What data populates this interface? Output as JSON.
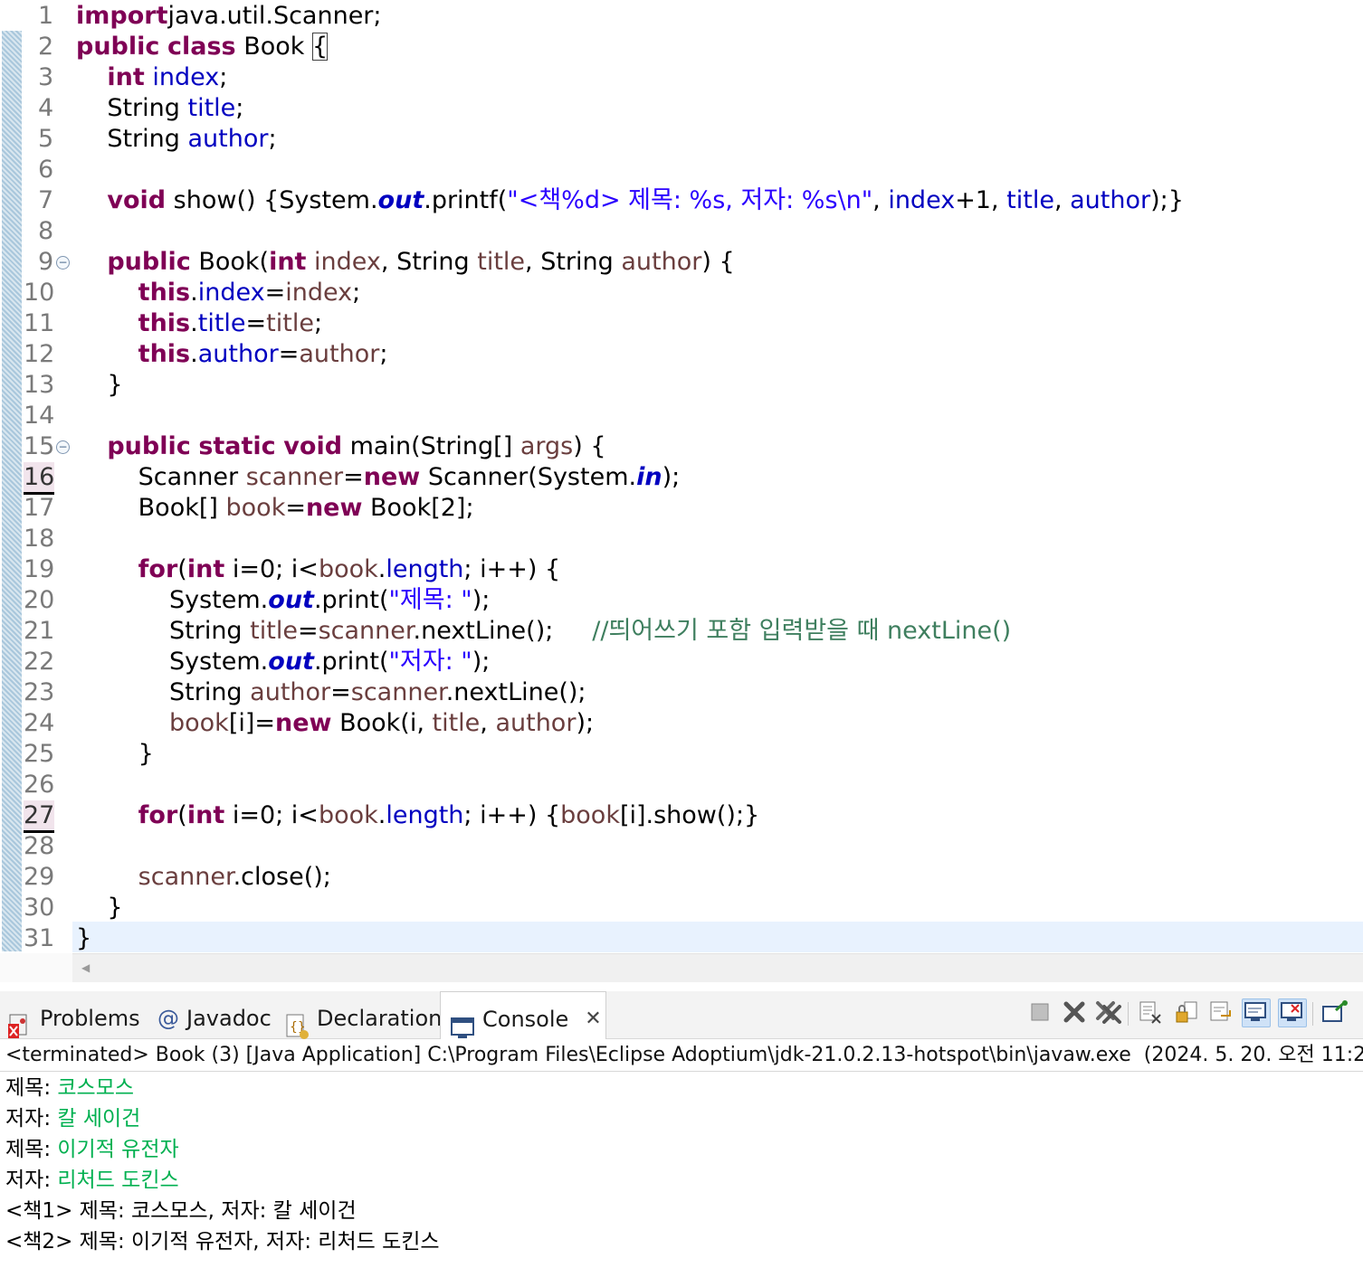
{
  "editor": {
    "line_numbers": [
      "1",
      "2",
      "3",
      "4",
      "5",
      "6",
      "7",
      "8",
      "9",
      "10",
      "11",
      "12",
      "13",
      "14",
      "15",
      "16",
      "17",
      "18",
      "19",
      "20",
      "21",
      "22",
      "23",
      "24",
      "25",
      "26",
      "27",
      "28",
      "29",
      "30",
      "31"
    ],
    "breakpoint_lines": [
      "16",
      "27"
    ],
    "fold_markers": [
      "⊖",
      "⊖"
    ],
    "lines": [
      [
        [
          "kw",
          "import"
        ],
        [
          "",
          "java.util.Scanner;"
        ]
      ],
      [
        [
          "kw",
          "public"
        ],
        [
          "",
          " "
        ],
        [
          "kw",
          "class"
        ],
        [
          "",
          " Book "
        ],
        [
          "brk",
          "{"
        ]
      ],
      [
        [
          "",
          "    "
        ],
        [
          "kw",
          "int"
        ],
        [
          "",
          " "
        ],
        [
          "fd",
          "index"
        ],
        [
          "",
          ";"
        ]
      ],
      [
        [
          "",
          "    String "
        ],
        [
          "fd",
          "title"
        ],
        [
          "",
          ";"
        ]
      ],
      [
        [
          "",
          "    String "
        ],
        [
          "fd",
          "author"
        ],
        [
          "",
          ";"
        ]
      ],
      [],
      [
        [
          "",
          "    "
        ],
        [
          "kw",
          "void"
        ],
        [
          "",
          " show() {System."
        ],
        [
          "sf",
          "out"
        ],
        [
          "",
          ".printf("
        ],
        [
          "st",
          "\"<책%d> 제목: %s, 저자: %s\\n\""
        ],
        [
          "",
          ", "
        ],
        [
          "fd",
          "index"
        ],
        [
          "",
          "+1, "
        ],
        [
          "fd",
          "title"
        ],
        [
          "",
          ", "
        ],
        [
          "fd",
          "author"
        ],
        [
          "",
          ");}"
        ]
      ],
      [],
      [
        [
          "",
          "    "
        ],
        [
          "kw",
          "public"
        ],
        [
          "",
          " Book("
        ],
        [
          "kw",
          "int"
        ],
        [
          "",
          " "
        ],
        [
          "vr",
          "index"
        ],
        [
          "",
          ", String "
        ],
        [
          "vr",
          "title"
        ],
        [
          "",
          ", String "
        ],
        [
          "vr",
          "author"
        ],
        [
          "",
          ") {"
        ]
      ],
      [
        [
          "",
          "        "
        ],
        [
          "kw",
          "this"
        ],
        [
          "",
          "."
        ],
        [
          "fd",
          "index"
        ],
        [
          "",
          "="
        ],
        [
          "vr",
          "index"
        ],
        [
          "",
          ";"
        ]
      ],
      [
        [
          "",
          "        "
        ],
        [
          "kw",
          "this"
        ],
        [
          "",
          "."
        ],
        [
          "fd",
          "title"
        ],
        [
          "",
          "="
        ],
        [
          "vr",
          "title"
        ],
        [
          "",
          ";"
        ]
      ],
      [
        [
          "",
          "        "
        ],
        [
          "kw",
          "this"
        ],
        [
          "",
          "."
        ],
        [
          "fd",
          "author"
        ],
        [
          "",
          "="
        ],
        [
          "vr",
          "author"
        ],
        [
          "",
          ";"
        ]
      ],
      [
        [
          "",
          "    }"
        ]
      ],
      [],
      [
        [
          "",
          "    "
        ],
        [
          "kw",
          "public"
        ],
        [
          "",
          " "
        ],
        [
          "kw",
          "static"
        ],
        [
          "",
          " "
        ],
        [
          "kw",
          "void"
        ],
        [
          "",
          " main(String[] "
        ],
        [
          "vr",
          "args"
        ],
        [
          "",
          ") {"
        ]
      ],
      [
        [
          "",
          "        Scanner "
        ],
        [
          "vr",
          "scanner"
        ],
        [
          "",
          "="
        ],
        [
          "kw",
          "new"
        ],
        [
          "",
          " Scanner(System."
        ],
        [
          "sf",
          "in"
        ],
        [
          "",
          ");"
        ]
      ],
      [
        [
          "",
          "        Book[] "
        ],
        [
          "vr",
          "book"
        ],
        [
          "",
          "="
        ],
        [
          "kw",
          "new"
        ],
        [
          "",
          " Book[2];"
        ]
      ],
      [],
      [
        [
          "",
          "        "
        ],
        [
          "kw",
          "for"
        ],
        [
          "",
          "("
        ],
        [
          "kw",
          "int"
        ],
        [
          "",
          " i=0; i<"
        ],
        [
          "vr",
          "book"
        ],
        [
          "",
          "."
        ],
        [
          "fd",
          "length"
        ],
        [
          "",
          "; i++) {"
        ]
      ],
      [
        [
          "",
          "            System."
        ],
        [
          "sf",
          "out"
        ],
        [
          "",
          ".print("
        ],
        [
          "st",
          "\"제목: \""
        ],
        [
          "",
          ");"
        ]
      ],
      [
        [
          "",
          "            String "
        ],
        [
          "vr",
          "title"
        ],
        [
          "",
          "="
        ],
        [
          "vr",
          "scanner"
        ],
        [
          "",
          ".nextLine();     "
        ],
        [
          "cm",
          "//띄어쓰기 포함 입력받을 때 nextLine()"
        ]
      ],
      [
        [
          "",
          "            System."
        ],
        [
          "sf",
          "out"
        ],
        [
          "",
          ".print("
        ],
        [
          "st",
          "\"저자: \""
        ],
        [
          "",
          ");"
        ]
      ],
      [
        [
          "",
          "            String "
        ],
        [
          "vr",
          "author"
        ],
        [
          "",
          "="
        ],
        [
          "vr",
          "scanner"
        ],
        [
          "",
          ".nextLine();"
        ]
      ],
      [
        [
          "",
          "            "
        ],
        [
          "vr",
          "book"
        ],
        [
          "",
          "[i]="
        ],
        [
          "kw",
          "new"
        ],
        [
          "",
          " Book(i, "
        ],
        [
          "vr",
          "title"
        ],
        [
          "",
          ", "
        ],
        [
          "vr",
          "author"
        ],
        [
          "",
          ");"
        ]
      ],
      [
        [
          "",
          "        }"
        ]
      ],
      [],
      [
        [
          "",
          "        "
        ],
        [
          "kw",
          "for"
        ],
        [
          "",
          "("
        ],
        [
          "kw",
          "int"
        ],
        [
          "",
          " i=0; i<"
        ],
        [
          "vr",
          "book"
        ],
        [
          "",
          "."
        ],
        [
          "fd",
          "length"
        ],
        [
          "",
          "; i++) {"
        ],
        [
          "vr",
          "book"
        ],
        [
          "",
          "[i].show();}"
        ]
      ],
      [],
      [
        [
          "",
          "        "
        ],
        [
          "vr",
          "scanner"
        ],
        [
          "",
          ".close();"
        ]
      ],
      [
        [
          "",
          "    }"
        ]
      ],
      [
        [
          "",
          "}"
        ]
      ]
    ]
  },
  "panel": {
    "tabs": {
      "problems": "Problems",
      "javadoc": "Javadoc",
      "declaration": "Declaration",
      "console": "Console"
    },
    "icons": {
      "problems": "problems-icon",
      "javadoc": "at-sign-icon",
      "declaration": "declaration-icon",
      "console": "console-icon",
      "close": "close-icon",
      "toolbar": [
        "terminate-icon",
        "remove-launch-icon",
        "remove-all-terminated-icon",
        "clear-console-icon",
        "scroll-lock-icon",
        "word-wrap-icon",
        "show-console-on-stdout-icon",
        "show-console-on-stderr-icon",
        "pin-console-icon"
      ]
    },
    "status": "<terminated> Book (3) [Java Application] C:\\Program Files\\Eclipse Adoptium\\jdk-21.0.2.13-hotspot\\bin\\javaw.exe  (2024. 5. 20. 오전 11:2",
    "console_lines": [
      {
        "prompt": "제목: ",
        "input": "코스모스"
      },
      {
        "prompt": "저자: ",
        "input": "칼 세이건"
      },
      {
        "prompt": "제목: ",
        "input": "이기적 유전자"
      },
      {
        "prompt": "저자: ",
        "input": "리처드 도킨스"
      },
      {
        "prompt": "<책1> 제목: 코스모스, 저자: 칼 세이건",
        "input": ""
      },
      {
        "prompt": "<책2> 제목: 이기적 유전자, 저자: 리처드 도킨스",
        "input": ""
      }
    ],
    "colors": {
      "input_text": "#00b050",
      "keyword": "#7f0055",
      "field": "#0000c0",
      "string": "#2a00ff",
      "comment": "#3f7f5f"
    }
  }
}
